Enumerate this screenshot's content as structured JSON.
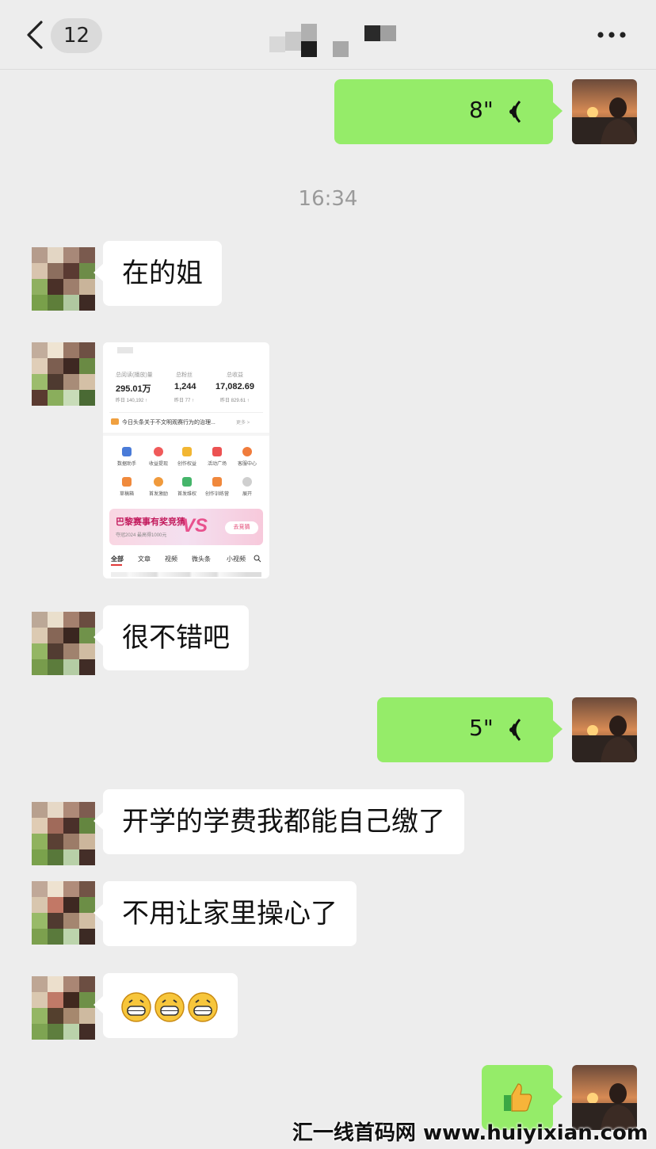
{
  "header": {
    "unread_count": "12",
    "back_icon": "chevron-left-icon",
    "more_icon": "more-dots-icon"
  },
  "messages": {
    "voice_1": {
      "duration": "8\""
    },
    "timestamp": "16:34",
    "text_1": "在的姐",
    "screenshot": {
      "stats_labels": [
        "总阅读(播放)量",
        "总粉丝",
        "总收益"
      ],
      "stats_values": [
        "295.01万",
        "1,244",
        "17,082.69"
      ],
      "stats_sub": [
        "昨日 140,192 ↑",
        "昨日 77 ↑",
        "昨日 829.61 ↑"
      ],
      "notice": "今日头条关于不文明观赛行为的治理...",
      "notice_more": "更多 >",
      "icons_row1": [
        "数据助手",
        "收益提现",
        "创作权益",
        "活动广场",
        "客服中心"
      ],
      "icons_row2": [
        "草稿箱",
        "首发激励",
        "首发维权",
        "创作训练营",
        "展开"
      ],
      "banner_title": "巴黎赛事有奖竞猜",
      "banner_sub": "夺冠2024 最高得1000元",
      "banner_vs": "VS",
      "banner_button": "去竞猜",
      "tabs": [
        "全部",
        "文章",
        "视频",
        "微头条",
        "小视频"
      ]
    },
    "text_2": "很不错吧",
    "voice_2": {
      "duration": "5\""
    },
    "text_3": "开学的学费我都能自己缴了",
    "text_4": "不用让家里操心了",
    "emoji_msg": "grin-emoji x3",
    "sticker": "thumbs-up-emoji"
  },
  "watermark": "汇一线首码网 www.huiyixian.com",
  "colors": {
    "background": "#ededed",
    "self_bubble": "#95ec69",
    "other_bubble": "#ffffff"
  }
}
